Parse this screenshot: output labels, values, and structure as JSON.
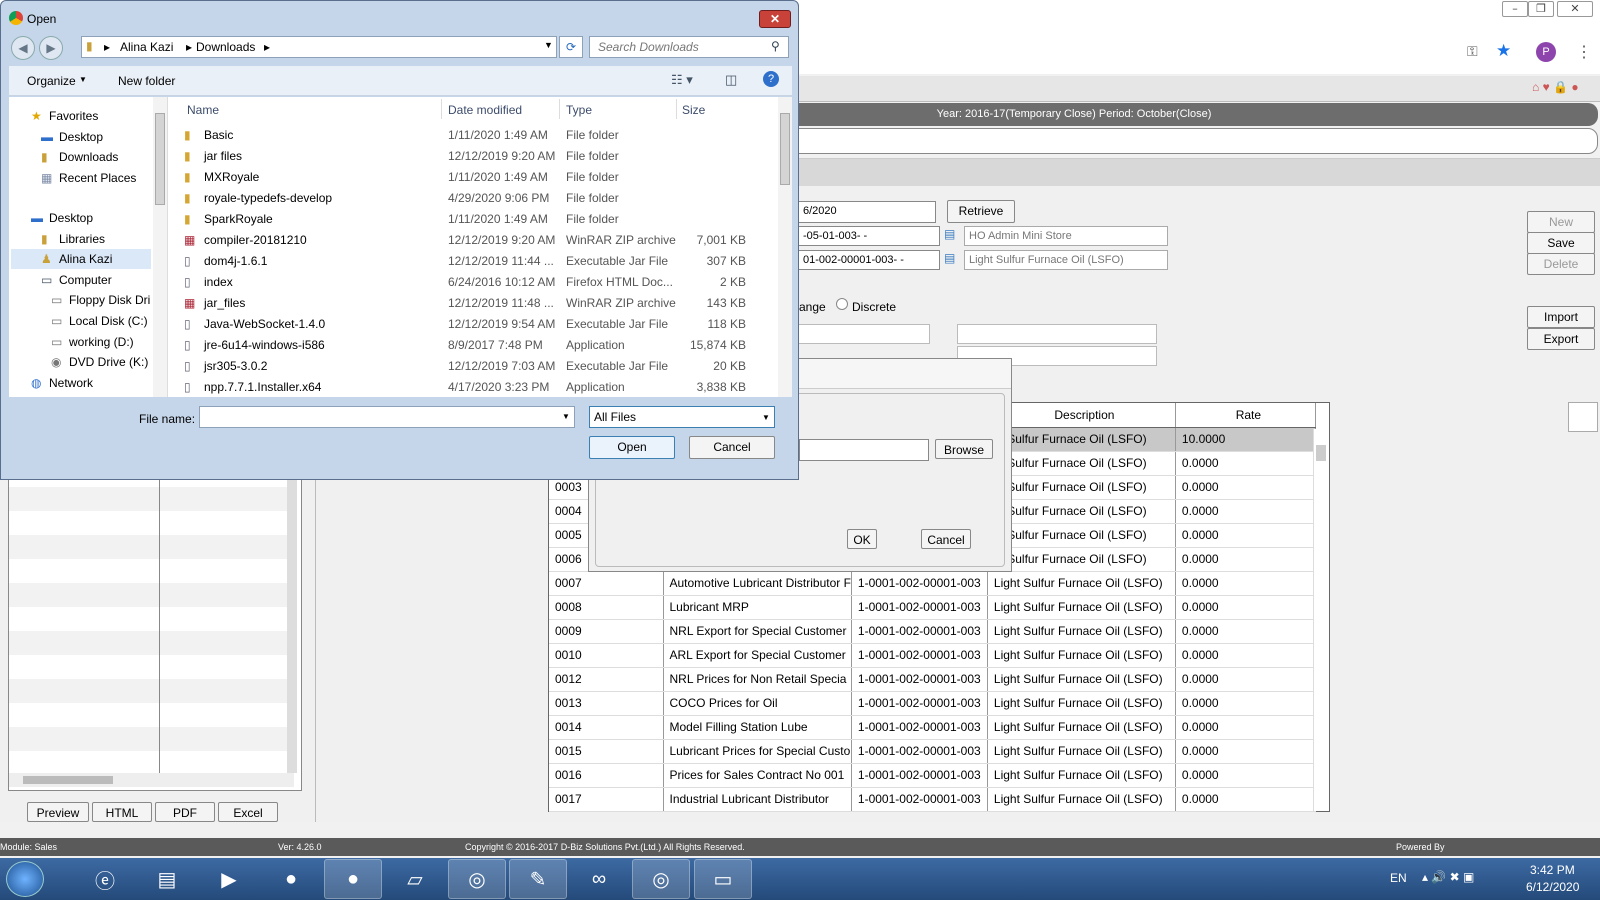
{
  "browser": {
    "avatar": "P"
  },
  "app": {
    "year_period": "Year: 2016-17(Temporary Close) Period: October(Close)",
    "date_value": "6/2020",
    "retrieve": "Retrieve",
    "field1": "-05-01-003-  -",
    "field1_desc": "HO Admin Mini Store",
    "field2": "01-002-00001-003- -",
    "field2_desc": "Light Sulfur Furnace Oil (LSFO)",
    "range_label": "ange",
    "discrete_label": "Discrete",
    "buttons": {
      "new": "New",
      "save": "Save",
      "delete": "Delete",
      "import": "Import",
      "export": "Export"
    },
    "bottom_tabs": [
      "Preview",
      "HTML",
      "PDF",
      "Excel"
    ]
  },
  "grid": {
    "headers": {
      "description": "Description",
      "rate": "Rate"
    },
    "rows": [
      {
        "code": "",
        "name": "",
        "item": "",
        "desc": "ht Sulfur Furnace Oil (LSFO)",
        "rate": "10.0000"
      },
      {
        "code": "",
        "name": "",
        "item": "",
        "desc": "ht Sulfur Furnace Oil (LSFO)",
        "rate": "0.0000"
      },
      {
        "code": "0003",
        "name": "",
        "item": "",
        "desc": "ht Sulfur Furnace Oil (LSFO)",
        "rate": "0.0000"
      },
      {
        "code": "0004",
        "name": "",
        "item": "",
        "desc": "ht Sulfur Furnace Oil (LSFO)",
        "rate": "0.0000"
      },
      {
        "code": "0005",
        "name": "",
        "item": "",
        "desc": "ht Sulfur Furnace Oil (LSFO)",
        "rate": "0.0000"
      },
      {
        "code": "0006",
        "name": "",
        "item": "",
        "desc": "ht Sulfur Furnace Oil (LSFO)",
        "rate": "0.0000"
      },
      {
        "code": "0007",
        "name": "Automotive Lubricant Distributor F",
        "item": "1-0001-002-00001-003",
        "desc": "Light Sulfur Furnace Oil (LSFO)",
        "rate": "0.0000"
      },
      {
        "code": "0008",
        "name": "Lubricant MRP",
        "item": "1-0001-002-00001-003",
        "desc": "Light Sulfur Furnace Oil (LSFO)",
        "rate": "0.0000"
      },
      {
        "code": "0009",
        "name": "NRL Export for Special Customer",
        "item": "1-0001-002-00001-003",
        "desc": "Light Sulfur Furnace Oil (LSFO)",
        "rate": "0.0000"
      },
      {
        "code": "0010",
        "name": "ARL Export for Special Customer",
        "item": "1-0001-002-00001-003",
        "desc": "Light Sulfur Furnace Oil (LSFO)",
        "rate": "0.0000"
      },
      {
        "code": "0012",
        "name": "NRL Prices for Non Retail Specia",
        "item": "1-0001-002-00001-003",
        "desc": "Light Sulfur Furnace Oil (LSFO)",
        "rate": "0.0000"
      },
      {
        "code": "0013",
        "name": "COCO Prices for Oil",
        "item": "1-0001-002-00001-003",
        "desc": "Light Sulfur Furnace Oil (LSFO)",
        "rate": "0.0000"
      },
      {
        "code": "0014",
        "name": "Model Filling Station Lube",
        "item": "1-0001-002-00001-003",
        "desc": "Light Sulfur Furnace Oil (LSFO)",
        "rate": "0.0000"
      },
      {
        "code": "0015",
        "name": "Lubricant Prices for Special Custo",
        "item": "1-0001-002-00001-003",
        "desc": "Light Sulfur Furnace Oil (LSFO)",
        "rate": "0.0000"
      },
      {
        "code": "0016",
        "name": "Prices for Sales Contract No 001",
        "item": "1-0001-002-00001-003",
        "desc": "Light Sulfur Furnace Oil (LSFO)",
        "rate": "0.0000"
      },
      {
        "code": "0017",
        "name": "Industrial Lubricant Distributor",
        "item": "1-0001-002-00001-003",
        "desc": "Light Sulfur Furnace Oil (LSFO)",
        "rate": "0.0000"
      }
    ]
  },
  "import_dialog": {
    "browse": "Browse",
    "ok": "OK",
    "cancel": "Cancel"
  },
  "open_dialog": {
    "title": "Open",
    "breadcrumb": [
      "Alina Kazi",
      "Downloads"
    ],
    "search_placeholder": "Search Downloads",
    "organize": "Organize",
    "new_folder": "New folder",
    "nav": [
      "Favorites",
      "Desktop",
      "Downloads",
      "Recent Places",
      "Desktop",
      "Libraries",
      "Alina Kazi",
      "Computer",
      "Floppy Disk Dri",
      "Local Disk (C:)",
      "working (D:)",
      "DVD Drive (K:)",
      "Network"
    ],
    "columns": {
      "name": "Name",
      "date": "Date modified",
      "type": "Type",
      "size": "Size"
    },
    "files": [
      {
        "name": "Basic",
        "date": "1/11/2020 1:49 AM",
        "type": "File folder",
        "size": ""
      },
      {
        "name": "jar files",
        "date": "12/12/2019 9:20 AM",
        "type": "File folder",
        "size": ""
      },
      {
        "name": "MXRoyale",
        "date": "1/11/2020 1:49 AM",
        "type": "File folder",
        "size": ""
      },
      {
        "name": "royale-typedefs-develop",
        "date": "4/29/2020 9:06 PM",
        "type": "File folder",
        "size": ""
      },
      {
        "name": "SparkRoyale",
        "date": "1/11/2020 1:49 AM",
        "type": "File folder",
        "size": ""
      },
      {
        "name": "compiler-20181210",
        "date": "12/12/2019 9:20 AM",
        "type": "WinRAR ZIP archive",
        "size": "7,001 KB"
      },
      {
        "name": "dom4j-1.6.1",
        "date": "12/12/2019 11:44 ...",
        "type": "Executable Jar File",
        "size": "307 KB"
      },
      {
        "name": "index",
        "date": "6/24/2016 10:12 AM",
        "type": "Firefox HTML Doc...",
        "size": "2 KB"
      },
      {
        "name": "jar_files",
        "date": "12/12/2019 11:48 ...",
        "type": "WinRAR ZIP archive",
        "size": "143 KB"
      },
      {
        "name": "Java-WebSocket-1.4.0",
        "date": "12/12/2019 9:54 AM",
        "type": "Executable Jar File",
        "size": "118 KB"
      },
      {
        "name": "jre-6u14-windows-i586",
        "date": "8/9/2017 7:48 PM",
        "type": "Application",
        "size": "15,874 KB"
      },
      {
        "name": "jsr305-3.0.2",
        "date": "12/12/2019 7:03 AM",
        "type": "Executable Jar File",
        "size": "20 KB"
      },
      {
        "name": "npp.7.7.1.Installer.x64",
        "date": "4/17/2020 3:23 PM",
        "type": "Application",
        "size": "3,838 KB"
      }
    ],
    "file_name_label": "File name:",
    "file_type": "All Files",
    "open": "Open",
    "cancel": "Cancel"
  },
  "status": {
    "module": "Module: Sales",
    "version": "Ver: 4.26.0",
    "copyright": "Copyright © 2016-2017 D-Biz Solutions Pvt.(Ltd.) All Rights Reserved.",
    "powered": "Powered By"
  },
  "taskbar": {
    "lang": "EN",
    "time": "3:42 PM",
    "date": "6/12/2020"
  }
}
